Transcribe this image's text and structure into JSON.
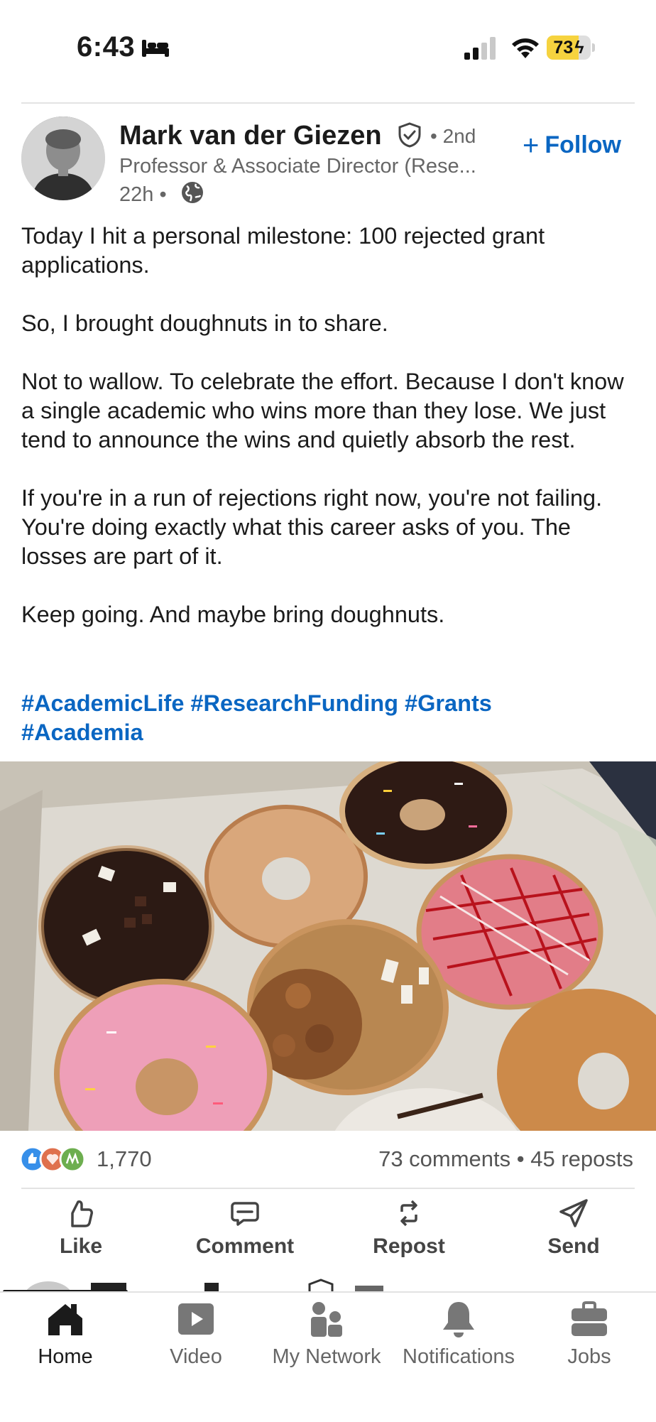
{
  "status_bar": {
    "time": "6:43",
    "focus_icon": "bed-icon",
    "battery_level": "73",
    "battery_fraction": 0.73,
    "battery_color": "#f6d33f"
  },
  "post": {
    "author": {
      "name": "Mark van der Giezen",
      "degree": "• 2nd",
      "headline": "Professor & Associate Director (Rese...",
      "time": "22h •"
    },
    "follow_label": "Follow",
    "paragraphs": [
      "Today I hit a personal milestone: 100 rejected grant applications.",
      "So, I brought doughnuts in to share.",
      "Not to wallow. To celebrate the effort. Because I don't know a single academic who wins more than they lose. We just tend to announce the wins and quietly absorb the rest.",
      "If you're in a run of rejections right now, you're not failing. You're doing exactly what this career asks of you. The losses are part of it.",
      "Keep going. And maybe bring doughnuts."
    ],
    "hashtags": {
      "line1": "#AcademicLife #ResearchFunding #Grants",
      "line2": "#Academia"
    },
    "stats": {
      "reactions": "1,770",
      "comments_reposts": "73 comments • 45 reposts"
    },
    "actions": [
      "Like",
      "Comment",
      "Repost",
      "Send"
    ]
  },
  "tabs": [
    {
      "label": "Home",
      "icon": "home-icon",
      "active": true
    },
    {
      "label": "Video",
      "icon": "video-icon"
    },
    {
      "label": "My Network",
      "icon": "network-icon"
    },
    {
      "label": "Notifications",
      "icon": "bell-icon"
    },
    {
      "label": "Jobs",
      "icon": "briefcase-icon"
    }
  ],
  "colors": {
    "brand": "#0a66c2",
    "text": "#1b1b1b",
    "muted": "#666666"
  }
}
